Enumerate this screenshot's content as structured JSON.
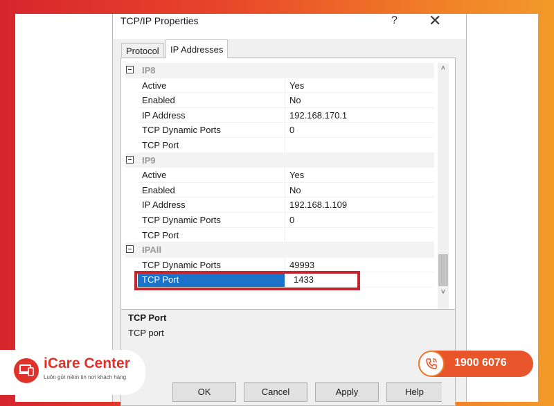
{
  "dialog": {
    "title": "TCP/IP Properties",
    "help_label": "?",
    "close_label": "✕"
  },
  "tabs": [
    {
      "label": "Protocol",
      "active": false
    },
    {
      "label": "IP Addresses",
      "active": true
    }
  ],
  "grid": {
    "rows": [
      {
        "kind": "category",
        "label": "IP8"
      },
      {
        "kind": "prop",
        "name": "Active",
        "value": "Yes"
      },
      {
        "kind": "prop",
        "name": "Enabled",
        "value": "No"
      },
      {
        "kind": "prop",
        "name": "IP Address",
        "value": "192.168.170.1"
      },
      {
        "kind": "prop",
        "name": "TCP Dynamic Ports",
        "value": "0"
      },
      {
        "kind": "prop",
        "name": "TCP Port",
        "value": ""
      },
      {
        "kind": "category",
        "label": "IP9"
      },
      {
        "kind": "prop",
        "name": "Active",
        "value": "Yes"
      },
      {
        "kind": "prop",
        "name": "Enabled",
        "value": "No"
      },
      {
        "kind": "prop",
        "name": "IP Address",
        "value": "192.168.1.109"
      },
      {
        "kind": "prop",
        "name": "TCP Dynamic Ports",
        "value": "0"
      },
      {
        "kind": "prop",
        "name": "TCP Port",
        "value": ""
      },
      {
        "kind": "category",
        "label": "IPAll"
      },
      {
        "kind": "prop",
        "name": "TCP Dynamic Ports",
        "value": "49993"
      },
      {
        "kind": "prop",
        "name": "TCP Port",
        "value": "1433",
        "selected": true
      }
    ]
  },
  "description": {
    "title": "TCP Port",
    "text": "TCP port"
  },
  "buttons": {
    "ok": "OK",
    "cancel": "Cancel",
    "apply": "Apply",
    "help": "Help"
  },
  "branding": {
    "name": "iCare Center",
    "tagline": "Luôn gửi niềm tin nơi khách hàng",
    "phone": "1900 6076"
  },
  "icons": {
    "scroll_up": "chevron-up-icon",
    "scroll_down": "chevron-down-icon",
    "collapse": "collapse-minus-icon",
    "phone": "phone-icon",
    "logo": "laptop-logo-icon"
  },
  "colors": {
    "selection": "#1a73c9",
    "highlight_border": "#c8262e",
    "brand_red": "#e0312a",
    "brand_orange": "#f07a28"
  }
}
